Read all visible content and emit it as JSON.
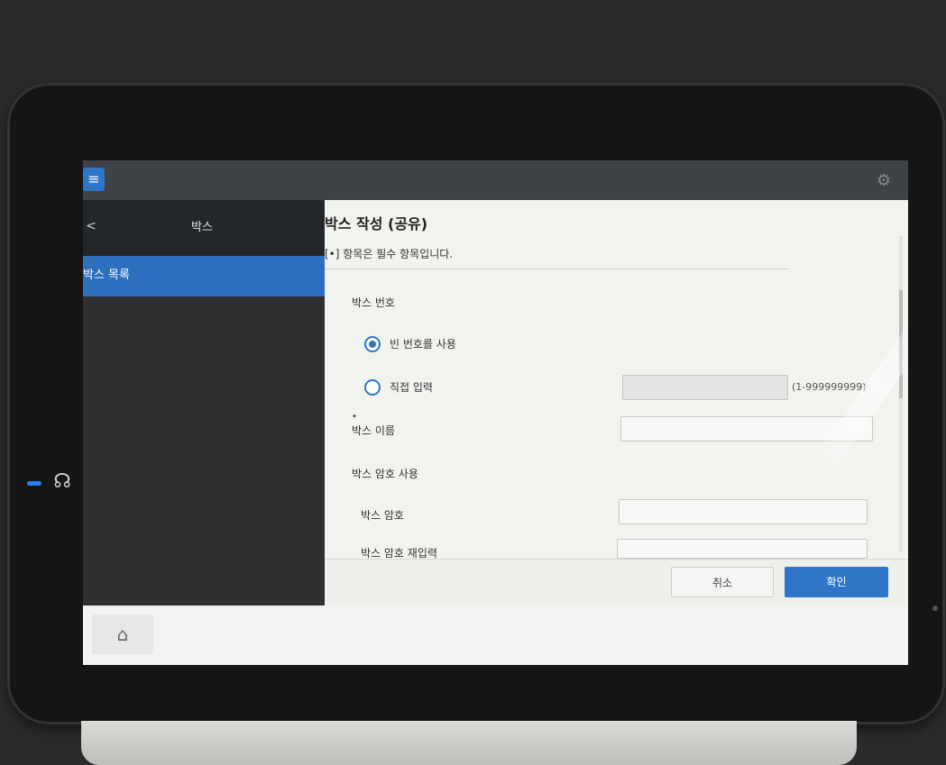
{
  "colors": {
    "accent": "#2f76c9",
    "sidebar_bg": "#2d2f31",
    "panel_bg": "#f1f3ef"
  },
  "topbar": {
    "menu_icon": "menu-icon",
    "right_icon": "settings-icon"
  },
  "sidebar": {
    "back_icon": "chevron-left-icon",
    "back_label": "<",
    "title": "박스",
    "items": [
      {
        "label": "박스 목록",
        "selected": true
      }
    ]
  },
  "main": {
    "title": "박스 작성 (공유)",
    "required_note": "[•] 항목은 필수 항목입니다.",
    "box_number": {
      "label": "박스 번호",
      "options": [
        {
          "label": "빈 번호를 사용",
          "selected": true
        },
        {
          "label": "직접 입력",
          "selected": false
        }
      ],
      "direct_input_value": "",
      "range_hint": "(1-999999999)"
    },
    "box_name": {
      "required_mark": "•",
      "label": "박스 이름",
      "value": ""
    },
    "password_use": {
      "label": "박스 암호 사용"
    },
    "password": {
      "label": "박스 암호",
      "value": ""
    },
    "password_confirm": {
      "label": "박스 암호 재입력",
      "value": ""
    },
    "buttons": {
      "cancel": "취소",
      "ok": "확인"
    }
  },
  "bottombar": {
    "home_icon": "home-icon"
  }
}
